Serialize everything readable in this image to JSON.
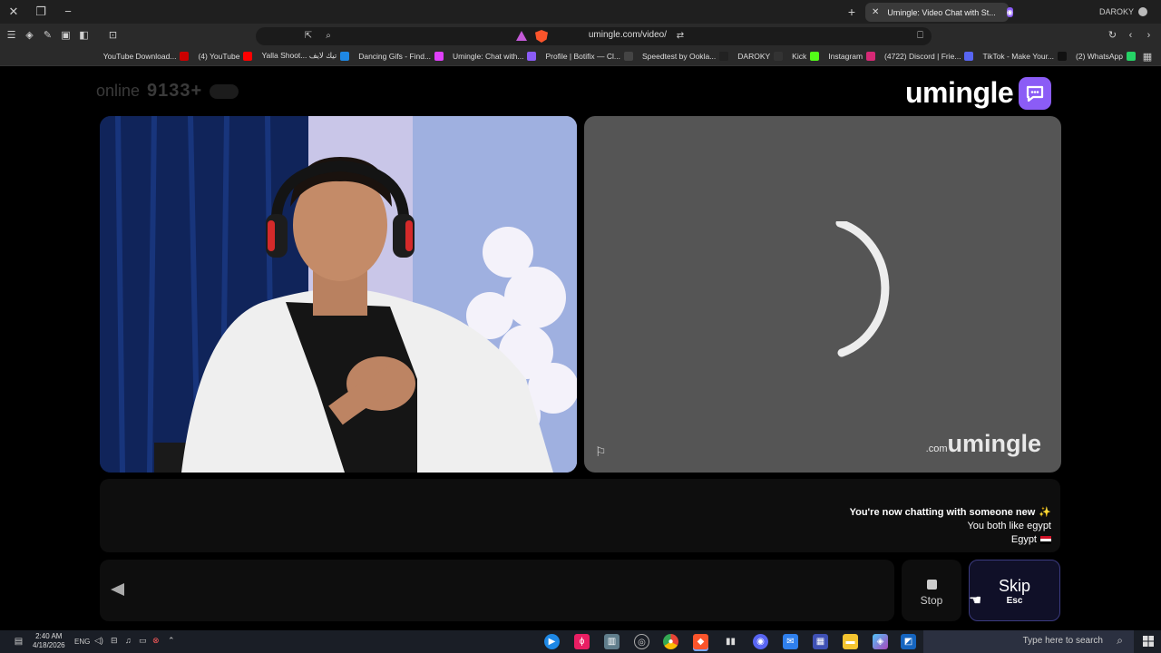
{
  "browser": {
    "profile_name": "DAROKY",
    "active_tab_title": "Umingle: Video Chat with St...",
    "url": "umingle.com/video/",
    "bookmarks": [
      {
        "label": "(2) WhatsApp",
        "color": "#25d366",
        "icon": "whatsapp-icon"
      },
      {
        "label": "TikTok - Make Your...",
        "color": "#111111",
        "icon": "tiktok-icon"
      },
      {
        "label": "(4722) Discord | Frie...",
        "color": "#5865f2",
        "icon": "discord-icon"
      },
      {
        "label": "Instagram",
        "color": "#d62976",
        "icon": "instagram-icon"
      },
      {
        "label": "Kick",
        "color": "#53fc18",
        "icon": "kick-icon"
      },
      {
        "label": "DAROKY",
        "color": "#333333",
        "icon": "daroky-icon"
      },
      {
        "label": "Speedtest by Ookla...",
        "color": "#222222",
        "icon": "speedtest-icon"
      },
      {
        "label": "Profile | Botifix — Cl...",
        "color": "#444444",
        "icon": "profile-icon"
      },
      {
        "label": "Umingle: Chat with...",
        "color": "#8b5cf6",
        "icon": "umingle-icon"
      },
      {
        "label": "Dancing Gifs - Find...",
        "color": "#e040fb",
        "icon": "giphy-icon"
      },
      {
        "label": "Yalla Shoot... تيك لايف",
        "color": "#1e88e5",
        "icon": "yalla-icon"
      },
      {
        "label": "(4) YouTube",
        "color": "#ff0000",
        "icon": "youtube-icon"
      },
      {
        "label": "YouTube Download...",
        "color": "#cc0000",
        "icon": "youtube-download-icon"
      }
    ]
  },
  "site": {
    "brand": "umingle",
    "online_count": "9133+",
    "online_label": "online",
    "watermark_brand": "umingle",
    "watermark_suffix": ".com"
  },
  "chat": {
    "system_message": "You're now chatting with someone new",
    "interest_message": "You both like egypt",
    "country": "Egypt"
  },
  "controls": {
    "skip_label": "Skip",
    "skip_key": "Esc",
    "stop_label": "Stop",
    "input_placeholder": ""
  },
  "taskbar": {
    "search_placeholder": "Type here to search",
    "time": "2:40 AM",
    "date": "4/18/2026",
    "language": "ENG"
  },
  "colors": {
    "accent": "#8b5cf6",
    "skip_border": "#3b3b80",
    "remote_bg": "#555555"
  }
}
